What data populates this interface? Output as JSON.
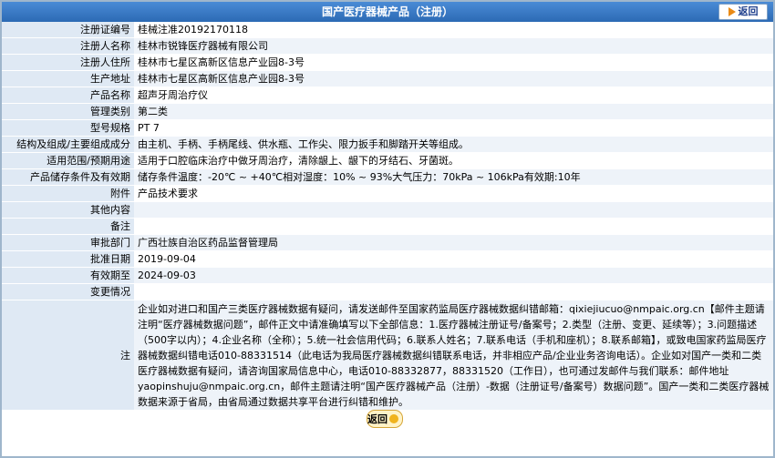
{
  "header": {
    "title": "国产医疗器械产品（注册）",
    "back_label": "返回"
  },
  "rows": [
    {
      "label": "注册证编号",
      "value": "桂械注准20192170118"
    },
    {
      "label": "注册人名称",
      "value": "桂林市锐锋医疗器械有限公司"
    },
    {
      "label": "注册人住所",
      "value": "桂林市七星区高新区信息产业园8-3号"
    },
    {
      "label": "生产地址",
      "value": "桂林市七星区高新区信息产业园8-3号"
    },
    {
      "label": "产品名称",
      "value": "超声牙周治疗仪"
    },
    {
      "label": "管理类别",
      "value": "第二类"
    },
    {
      "label": "型号规格",
      "value": "PT 7"
    },
    {
      "label": "结构及组成/主要组成成分",
      "value": "由主机、手柄、手柄尾线、供水瓶、工作尖、限力扳手和脚踏开关等组成。"
    },
    {
      "label": "适用范围/预期用途",
      "value": "适用于口腔临床治疗中做牙周治疗，清除龈上、龈下的牙结石、牙菌斑。"
    },
    {
      "label": "产品储存条件及有效期",
      "value": "储存条件温度：-20℃ ~ +40℃相对湿度：10% ~ 93%大气压力：70kPa ~ 106kPa有效期:10年"
    },
    {
      "label": "附件",
      "value": "产品技术要求"
    },
    {
      "label": "其他内容",
      "value": ""
    },
    {
      "label": "备注",
      "value": ""
    },
    {
      "label": "审批部门",
      "value": "广西壮族自治区药品监督管理局"
    },
    {
      "label": "批准日期",
      "value": "2019-09-04"
    },
    {
      "label": "有效期至",
      "value": "2024-09-03"
    },
    {
      "label": "变更情况",
      "value": ""
    }
  ],
  "notice": {
    "label": "注",
    "text": "企业如对进口和国产三类医疗器械数据有疑问，请发送邮件至国家药监局医疗器械数据纠错邮箱：qixiejiucuo@nmpaic.org.cn【邮件主题请注明“医疗器械数据问题”，邮件正文中请准确填写以下全部信息：1.医疗器械注册证号/备案号；2.类型（注册、变更、延续等）；3.问题描述（500字以内）；4.企业名称（全称）；5.统一社会信用代码；6.联系人姓名；7.联系电话（手机和座机）；8.联系邮箱】，或致电国家药监局医疗器械数据纠错电话010-88331514（此电话为我局医疗器械数据纠错联系电话，并非相应产品/企业业务咨询电话）。企业如对国产一类和二类医疗器械数据有疑问，请咨询国家局信息中心，电话010-88332877，88331520（工作日），也可通过发邮件与我们联系：邮件地址yaopinshuju@nmpaic.org.cn，邮件主题请注明“国产医疗器械产品（注册）-数据（注册证号/备案号）数据问题”。国产一类和二类医疗器械数据来源于省局，由省局通过数据共享平台进行纠错和维护。"
  },
  "footer": {
    "back_label": "返回"
  }
}
